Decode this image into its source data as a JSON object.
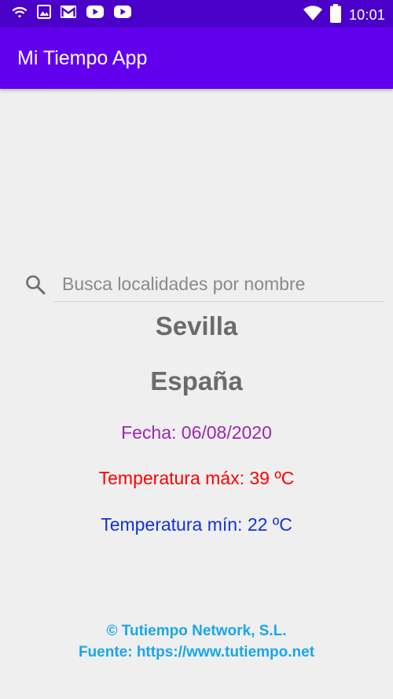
{
  "status_bar": {
    "time": "10:01",
    "left_icons": [
      "wifi-icon",
      "image-icon",
      "gmail-icon",
      "youtube-icon",
      "youtube-icon"
    ],
    "right_icons": [
      "wifi-signal-icon",
      "battery-icon"
    ],
    "background": "#4a00c9"
  },
  "app_bar": {
    "title": "Mi Tiempo App",
    "background": "#6200ee"
  },
  "search": {
    "placeholder": "Busca localidades por nombre",
    "value": ""
  },
  "location": {
    "city": "Sevilla",
    "country": "España"
  },
  "weather": {
    "date_label": "Fecha: 06/08/2020",
    "temp_max_label": "Temperatura máx: 39 ºC",
    "temp_min_label": "Temperatura mín: 22 ºC"
  },
  "footer": {
    "copyright": "© Tutiempo Network, S.L.",
    "source": "Fuente: https://www.tutiempo.net"
  },
  "colors": {
    "date": "#9c27b0",
    "temp_max": "#ff0000",
    "temp_min": "#1432d6",
    "footer": "#1aa6e8",
    "location": "#6b6b6b"
  }
}
